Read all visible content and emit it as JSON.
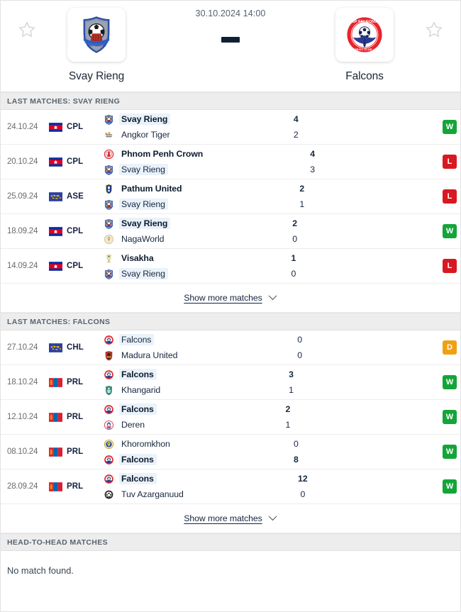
{
  "header": {
    "kickoff": "30.10.2024 14:00",
    "score_placeholder": "-",
    "home": {
      "name": "Svay Rieng",
      "logo": "svay-rieng-crest"
    },
    "away": {
      "name": "Falcons",
      "logo": "falcons-crest"
    },
    "star_left": "star-outline-icon",
    "star_right": "star-outline-icon"
  },
  "sections": [
    {
      "id": "last-matches-svay-rieng",
      "title": "LAST MATCHES: SVAY RIENG",
      "show_more_label": "Show more matches",
      "matches": [
        {
          "date": "24.10.24",
          "league": "CPL",
          "flag": "cambodia",
          "home": {
            "name": "Svay Rieng",
            "bold": true,
            "highlight": true,
            "logo": "svay-rieng"
          },
          "away": {
            "name": "Angkor Tiger",
            "bold": false,
            "highlight": false,
            "logo": "angkor-tiger"
          },
          "home_score": "4",
          "away_score": "2",
          "home_score_bold": true,
          "away_score_bold": false,
          "result": "W"
        },
        {
          "date": "20.10.24",
          "league": "CPL",
          "flag": "cambodia",
          "home": {
            "name": "Phnom Penh Crown",
            "bold": true,
            "highlight": false,
            "logo": "phnom-penh-crown"
          },
          "away": {
            "name": "Svay Rieng",
            "bold": false,
            "highlight": true,
            "logo": "svay-rieng"
          },
          "home_score": "4",
          "away_score": "3",
          "home_score_bold": true,
          "away_score_bold": false,
          "result": "L"
        },
        {
          "date": "25.09.24",
          "league": "ASE",
          "flag": "afc",
          "home": {
            "name": "Pathum United",
            "bold": true,
            "highlight": false,
            "logo": "pathum-united"
          },
          "away": {
            "name": "Svay Rieng",
            "bold": false,
            "highlight": true,
            "logo": "svay-rieng"
          },
          "home_score": "2",
          "away_score": "1",
          "home_score_bold": true,
          "away_score_bold": false,
          "result": "L"
        },
        {
          "date": "18.09.24",
          "league": "CPL",
          "flag": "cambodia",
          "home": {
            "name": "Svay Rieng",
            "bold": true,
            "highlight": true,
            "logo": "svay-rieng"
          },
          "away": {
            "name": "NagaWorld",
            "bold": false,
            "highlight": false,
            "logo": "nagaworld"
          },
          "home_score": "2",
          "away_score": "0",
          "home_score_bold": true,
          "away_score_bold": false,
          "result": "W"
        },
        {
          "date": "14.09.24",
          "league": "CPL",
          "flag": "cambodia",
          "home": {
            "name": "Visakha",
            "bold": true,
            "highlight": false,
            "logo": "visakha"
          },
          "away": {
            "name": "Svay Rieng",
            "bold": false,
            "highlight": true,
            "logo": "svay-rieng"
          },
          "home_score": "1",
          "away_score": "0",
          "home_score_bold": true,
          "away_score_bold": false,
          "result": "L"
        }
      ]
    },
    {
      "id": "last-matches-falcons",
      "title": "LAST MATCHES: FALCONS",
      "show_more_label": "Show more matches",
      "matches": [
        {
          "date": "27.10.24",
          "league": "CHL",
          "flag": "afc",
          "home": {
            "name": "Falcons",
            "bold": false,
            "highlight": true,
            "logo": "falcons"
          },
          "away": {
            "name": "Madura United",
            "bold": false,
            "highlight": false,
            "logo": "madura-united"
          },
          "home_score": "0",
          "away_score": "0",
          "home_score_bold": false,
          "away_score_bold": false,
          "result": "D"
        },
        {
          "date": "18.10.24",
          "league": "PRL",
          "flag": "mongolia",
          "home": {
            "name": "Falcons",
            "bold": true,
            "highlight": true,
            "logo": "falcons"
          },
          "away": {
            "name": "Khangarid",
            "bold": false,
            "highlight": false,
            "logo": "khangarid"
          },
          "home_score": "3",
          "away_score": "1",
          "home_score_bold": true,
          "away_score_bold": false,
          "result": "W"
        },
        {
          "date": "12.10.24",
          "league": "PRL",
          "flag": "mongolia",
          "home": {
            "name": "Falcons",
            "bold": true,
            "highlight": true,
            "logo": "falcons"
          },
          "away": {
            "name": "Deren",
            "bold": false,
            "highlight": false,
            "logo": "deren"
          },
          "home_score": "2",
          "away_score": "1",
          "home_score_bold": true,
          "away_score_bold": false,
          "result": "W"
        },
        {
          "date": "08.10.24",
          "league": "PRL",
          "flag": "mongolia",
          "home": {
            "name": "Khoromkhon",
            "bold": false,
            "highlight": false,
            "logo": "khoromkhon"
          },
          "away": {
            "name": "Falcons",
            "bold": true,
            "highlight": true,
            "logo": "falcons"
          },
          "home_score": "0",
          "away_score": "8",
          "home_score_bold": false,
          "away_score_bold": true,
          "result": "W"
        },
        {
          "date": "28.09.24",
          "league": "PRL",
          "flag": "mongolia",
          "home": {
            "name": "Falcons",
            "bold": true,
            "highlight": true,
            "logo": "falcons"
          },
          "away": {
            "name": "Tuv Azarganuud",
            "bold": false,
            "highlight": false,
            "logo": "tuv-azarganuud"
          },
          "home_score": "12",
          "away_score": "0",
          "home_score_bold": true,
          "away_score_bold": false,
          "result": "W"
        }
      ]
    }
  ],
  "head_to_head": {
    "title": "HEAD-TO-HEAD MATCHES",
    "empty_text": "No match found."
  },
  "colors": {
    "win": "#13a538",
    "loss": "#d81921",
    "draw": "#efa113",
    "section_bg": "#ededed",
    "highlight": "#eaf2fa",
    "text_dark": "#17283e"
  }
}
